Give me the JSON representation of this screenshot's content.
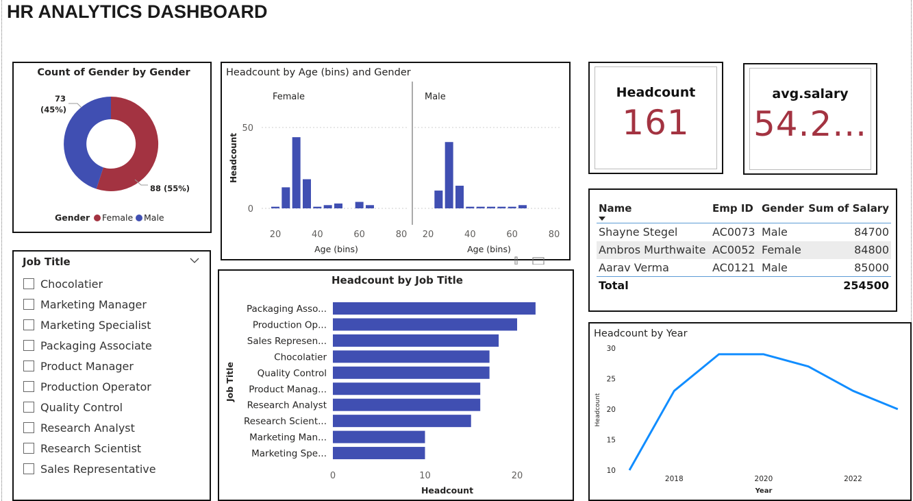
{
  "dashboard": {
    "title": "HR ANALYTICS DASHBOARD"
  },
  "colors": {
    "female": "#a33341",
    "male": "#404fb2",
    "line": "#118dff",
    "kpi_value": "#a33341"
  },
  "donut": {
    "title": "Count of Gender by Gender",
    "legend_title": "Gender",
    "male_label_count": "73",
    "male_label_pct": "(45%)",
    "female_label": "88 (55%)",
    "legend": [
      {
        "name": "Female",
        "color": "#a33341"
      },
      {
        "name": "Male",
        "color": "#404fb2"
      }
    ]
  },
  "age_chart": {
    "title": "Headcount by Age (bins) and Gender",
    "ylabel": "Headcount",
    "xlabel_female": "Age (bins)",
    "xlabel_male": "Age (bins)",
    "panel_female": "Female",
    "panel_male": "Male",
    "ytick_50": "50",
    "ytick_0": "0",
    "xticks": [
      "20",
      "40",
      "60",
      "80"
    ]
  },
  "kpis": {
    "headcount_label": "Headcount",
    "headcount_value": "161",
    "salary_label": "avg.salary",
    "salary_value": "54.2..."
  },
  "table": {
    "headers": {
      "name": "Name",
      "emp_id": "Emp ID",
      "gender": "Gender",
      "salary": "Sum of Salary"
    },
    "rows": [
      {
        "name": "Shayne Stegel",
        "emp_id": "AC0073",
        "gender": "Male",
        "salary": "84700"
      },
      {
        "name": "Ambros Murthwaite",
        "emp_id": "AC0052",
        "gender": "Female",
        "salary": "84800"
      },
      {
        "name": "Aarav Verma",
        "emp_id": "AC0121",
        "gender": "Male",
        "salary": "85000"
      }
    ],
    "total_label": "Total",
    "total_value": "254500"
  },
  "slicer": {
    "title": "Job Title",
    "items": [
      "Chocolatier",
      "Marketing Manager",
      "Marketing Specialist",
      "Packaging Associate",
      "Product Manager",
      "Production Operator",
      "Quality Control",
      "Research Analyst",
      "Research Scientist",
      "Sales Representative"
    ]
  },
  "chart_data": [
    {
      "type": "bar",
      "title": "Headcount by Age (bins) and Gender",
      "xlabel": "Age (bins)",
      "ylabel": "Headcount",
      "ylim": [
        0,
        50
      ],
      "xlim": [
        15,
        80
      ],
      "series": [
        {
          "name": "Female",
          "x": [
            20,
            25,
            30,
            35,
            40,
            45,
            50,
            60,
            65
          ],
          "values": [
            1,
            13,
            44,
            18,
            1,
            2,
            3,
            4,
            2
          ]
        },
        {
          "name": "Male",
          "x": [
            25,
            30,
            35,
            40,
            45,
            50,
            55,
            60,
            65
          ],
          "values": [
            11,
            41,
            14,
            1,
            1,
            1,
            1,
            1,
            2
          ]
        }
      ]
    },
    {
      "type": "bar",
      "orientation": "horizontal",
      "title": "Headcount by Job Title",
      "xlabel": "Headcount",
      "ylabel": "Job Title",
      "xlim": [
        0,
        22
      ],
      "xticks": [
        "0",
        "10",
        "20"
      ],
      "categories": [
        "Packaging Asso...",
        "Production Op...",
        "Sales Represen...",
        "Chocolatier",
        "Quality Control",
        "Product Manag...",
        "Research Analyst",
        "Research Scient...",
        "Marketing Man...",
        "Marketing Spe..."
      ],
      "values": [
        22,
        20,
        18,
        17,
        17,
        16,
        16,
        15,
        10,
        10
      ]
    },
    {
      "type": "line",
      "title": "Headcount by Year",
      "xlabel": "Year",
      "ylabel": "Headcount",
      "ylim": [
        10,
        30
      ],
      "yticks": [
        "10",
        "15",
        "20",
        "25",
        "30"
      ],
      "xticks": [
        "2018",
        "2020",
        "2022"
      ],
      "x": [
        2017,
        2018,
        2019,
        2020,
        2021,
        2022,
        2023
      ],
      "values": [
        10,
        23,
        29,
        29,
        27,
        23,
        20
      ]
    }
  ]
}
